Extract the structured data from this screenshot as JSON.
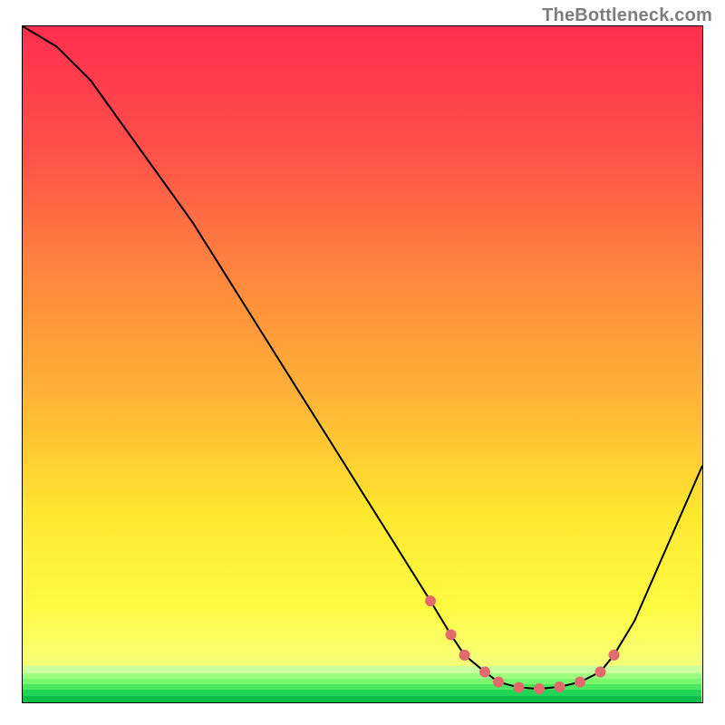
{
  "watermark": "TheBottleneck.com",
  "colors": {
    "curve_stroke": "#000000",
    "marker_fill": "#e36a6a"
  },
  "chart_data": {
    "type": "line",
    "title": "",
    "xlabel": "",
    "ylabel": "",
    "xlim": [
      0,
      100
    ],
    "ylim": [
      0,
      100
    ],
    "x": [
      0,
      5,
      10,
      15,
      20,
      25,
      30,
      35,
      40,
      45,
      50,
      55,
      60,
      63,
      65,
      68,
      70,
      73,
      76,
      79,
      82,
      85,
      87,
      90,
      100
    ],
    "values": [
      100,
      97,
      92,
      85,
      78,
      71,
      63,
      55,
      47,
      39,
      31,
      23,
      15,
      10,
      7,
      4.5,
      3,
      2.2,
      2,
      2.3,
      3,
      4.5,
      7,
      12,
      35
    ],
    "marker_indices": [
      12,
      13,
      14,
      15,
      16,
      17,
      18,
      19,
      20,
      21,
      22
    ],
    "annotations": []
  }
}
